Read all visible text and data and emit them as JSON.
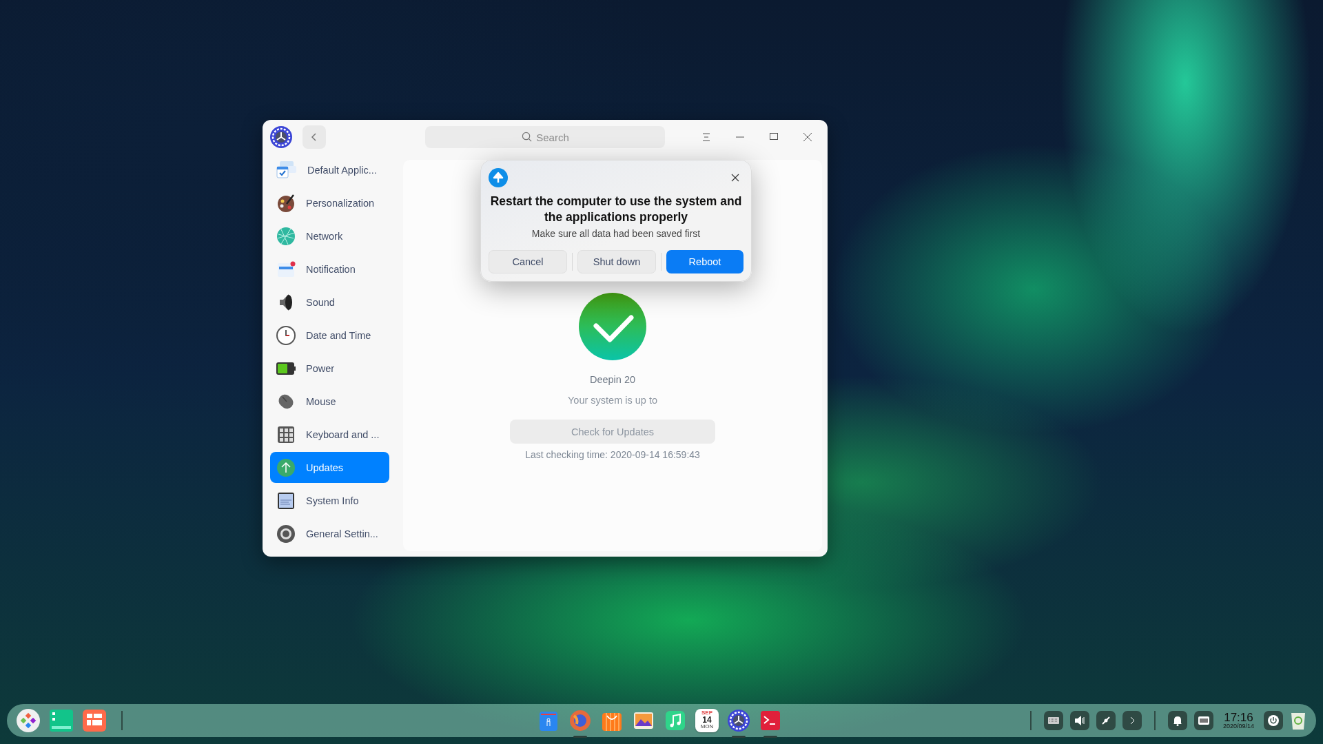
{
  "window": {
    "search": {
      "placeholder": "Search"
    }
  },
  "sidebar": {
    "items": [
      {
        "label": "Default Applic...",
        "selected": false
      },
      {
        "label": "Personalization",
        "selected": false
      },
      {
        "label": "Network",
        "selected": false
      },
      {
        "label": "Notification",
        "selected": false
      },
      {
        "label": "Sound",
        "selected": false
      },
      {
        "label": "Date and Time",
        "selected": false
      },
      {
        "label": "Power",
        "selected": false
      },
      {
        "label": "Mouse",
        "selected": false
      },
      {
        "label": "Keyboard and ...",
        "selected": false
      },
      {
        "label": "Updates",
        "selected": true
      },
      {
        "label": "System Info",
        "selected": false
      },
      {
        "label": "General Settin...",
        "selected": false
      }
    ]
  },
  "content": {
    "version": "Deepin 20",
    "status": "Your system is up to",
    "check_button": "Check for Updates",
    "last_checked": "Last checking time: 2020-09-14 16:59:43"
  },
  "dialog": {
    "title": "Restart the computer to use the system and the applications properly",
    "message": "Make sure all data had been saved first",
    "buttons": [
      {
        "label": "Cancel",
        "primary": false
      },
      {
        "label": "Shut down",
        "primary": false
      },
      {
        "label": "Reboot",
        "primary": true
      }
    ]
  },
  "dock": {
    "apps": [
      {
        "kind": "app",
        "running": false
      },
      {
        "kind": "app",
        "running": true
      },
      {
        "kind": "app",
        "running": false
      },
      {
        "kind": "app",
        "running": false
      },
      {
        "kind": "app",
        "running": false
      },
      {
        "kind": "calendar",
        "running": false,
        "month": "SEP",
        "day": "14",
        "weekday": "MON"
      },
      {
        "kind": "app",
        "running": true
      },
      {
        "kind": "app",
        "running": true
      }
    ],
    "clock": {
      "time": "17:16",
      "date": "2020/09/14"
    }
  }
}
